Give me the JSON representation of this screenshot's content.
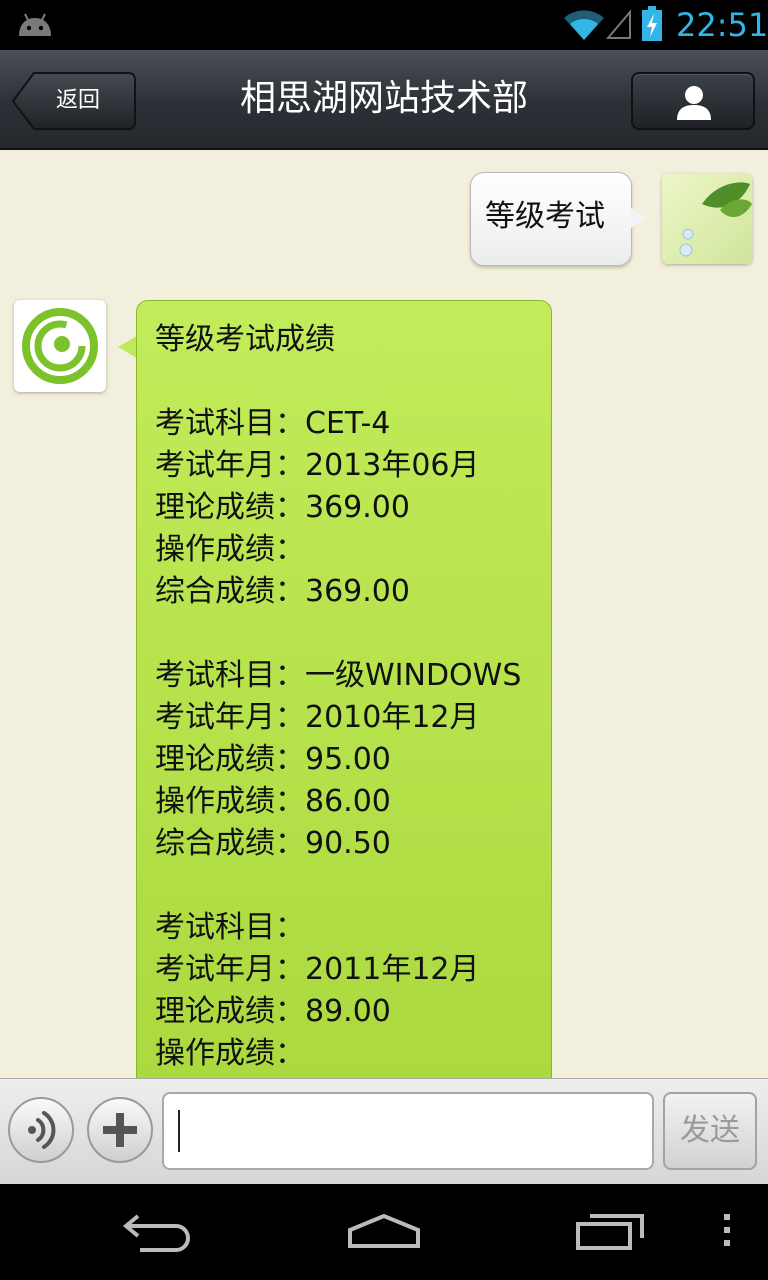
{
  "status_bar": {
    "time": "22:51",
    "icons": [
      "android-icon",
      "wifi-icon",
      "signal-icon",
      "battery-charging-icon"
    ],
    "accent_color": "#33b5e5"
  },
  "header": {
    "back_label": "返回",
    "title": "相思湖网站技术部",
    "profile_icon": "person-icon"
  },
  "chat": {
    "background": "#f2efdc",
    "messages": [
      {
        "from": "me",
        "text": "等级考试"
      },
      {
        "from": "bot",
        "bubble_color": "#b6e04a",
        "lines": [
          "等级考试成绩",
          "",
          "考试科目：CET-4",
          "考试年月：2013年06月",
          "理论成绩：369.00",
          "操作成绩：",
          "综合成绩：369.00",
          "",
          "考试科目：一级WINDOWS",
          "考试年月：2010年12月",
          "理论成绩：95.00",
          "操作成绩：86.00",
          "综合成绩：90.50",
          "",
          "考试科目：",
          "考试年月：2011年12月",
          "理论成绩：89.00",
          "操作成绩："
        ]
      }
    ]
  },
  "input_bar": {
    "voice_icon": "voice-icon",
    "plus_icon": "plus-icon",
    "text_value": "",
    "send_label": "发送"
  },
  "nav_bar": {
    "icons": [
      "back-nav-icon",
      "home-nav-icon",
      "recent-apps-icon",
      "overflow-menu-icon"
    ]
  }
}
